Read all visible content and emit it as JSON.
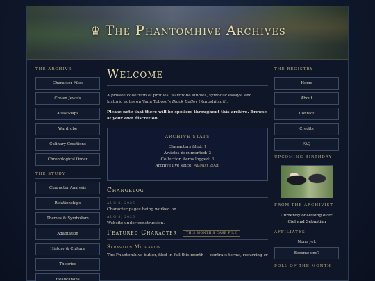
{
  "site": {
    "title": "The Phantomhive Archives",
    "crown_glyph": "♛"
  },
  "left_nav": {
    "archive_heading": "The Archive",
    "archive_items": [
      "Character Files",
      "Crown Jewels",
      "Atlas/Maps",
      "Wardrobe",
      "Culinary Creations",
      "Chronological Order"
    ],
    "study_heading": "The Study",
    "study_items": [
      "Character Analysis",
      "Relationships",
      "Themes & Symbolism",
      "Adaptation",
      "History & Culture",
      "Theories",
      "Headcanons"
    ]
  },
  "main": {
    "heading": "Welcome",
    "intro_prefix": "A private collection of profiles, wardrobe studies, symbolic essays, and historic notes on Yana Toboso's ",
    "intro_title": "Black Butler",
    "intro_suffix": " (Kuroshitsuji).",
    "warning": "Please note that there will be spoilers throughout this archive. Browse at your own discretion.",
    "stats": {
      "title": "Archive Stats",
      "lines": [
        {
          "label": "Characters filed: ",
          "value": "1"
        },
        {
          "label": "Articles documented: ",
          "value": "2"
        },
        {
          "label": "Collection items logged: ",
          "value": "3"
        },
        {
          "label": "Archive live since: ",
          "value": "August 2026"
        }
      ]
    },
    "changelog": {
      "heading": "Changelog",
      "entries": [
        {
          "date": "Aug 8, 2026",
          "text": "Character pages being worked on."
        },
        {
          "date": "Aug 8, 2026",
          "text": "Website under construction."
        }
      ]
    },
    "featured": {
      "heading": "Featured Character",
      "tag": "This month's case file",
      "name": "Sebastian Michaelis",
      "text": "The Phantomhive butler, filed in full this month — contract terms, recurring crow and"
    }
  },
  "right_nav": {
    "registry_heading": "The Registry",
    "registry_items": [
      "Home",
      "About",
      "Contact",
      "Credits",
      "FAQ"
    ],
    "birthday_heading": "Upcoming Birthday",
    "from_heading": "From the Archivist",
    "from_line1": "Currently obsessing over:",
    "from_line2": "Ciel and Sebastian",
    "affiliates_heading": "Affiliates",
    "affiliates_text": "None yet.",
    "affiliates_button": "Become one?",
    "poll_heading": "Poll of the Month"
  }
}
